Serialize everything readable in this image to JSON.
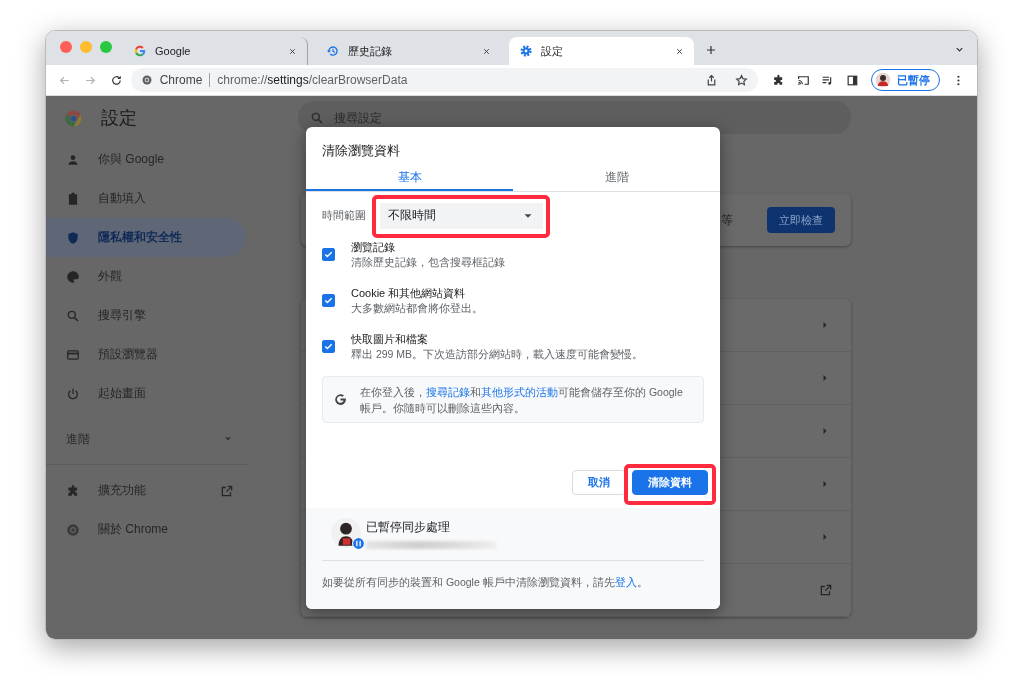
{
  "window": {
    "tabs": [
      {
        "title": "Google",
        "selected": false
      },
      {
        "title": "歷史記錄",
        "selected": false
      },
      {
        "title": "設定",
        "selected": true
      }
    ],
    "address_bar": {
      "site_label": "Chrome",
      "url": "chrome://**settings**/clearBrowserData"
    },
    "profile_chip": {
      "label": "已暫停"
    }
  },
  "settings": {
    "title": "設定",
    "search": {
      "placeholder": "搜尋設定"
    },
    "sidebar": {
      "items": [
        {
          "label": "你與 Google",
          "selected": false
        },
        {
          "label": "自動填入",
          "selected": false
        },
        {
          "label": "隱私權和安全性",
          "selected": true
        },
        {
          "label": "外觀",
          "selected": false
        },
        {
          "label": "搜尋引擎",
          "selected": false
        },
        {
          "label": "預設瀏覽器",
          "selected": false
        },
        {
          "label": "起始畫面",
          "selected": false
        }
      ],
      "advanced": {
        "label": "進階",
        "expanded": false
      },
      "bottom_items": [
        {
          "label": "擴充功能",
          "external": true
        },
        {
          "label": "關於 Chrome",
          "external": false
        }
      ]
    },
    "main": {
      "safety_card": {
        "text": "等",
        "button": "立即檢查"
      },
      "rows": [
        {
          "kind": "arrow"
        },
        {
          "kind": "arrow"
        },
        {
          "kind": "arrow"
        },
        {
          "kind": "arrow"
        },
        {
          "kind": "arrow"
        },
        {
          "kind": "external"
        }
      ]
    }
  },
  "dialog": {
    "title": "清除瀏覽資料",
    "tabs": [
      {
        "label": "基本",
        "selected": true
      },
      {
        "label": "進階",
        "selected": false
      }
    ],
    "time_range": {
      "label": "時間範圍",
      "value": "不限時間",
      "highlighted": true
    },
    "options": [
      {
        "title": "瀏覽記錄",
        "description": "清除歷史記錄，包含搜尋框記錄",
        "checked": true
      },
      {
        "title": "Cookie 和其他網站資料",
        "description": "大多數網站都會將你登出。",
        "checked": true
      },
      {
        "title": "快取圖片和檔案",
        "description": "釋出 299 MB。下次造訪部分網站時，載入速度可能會變慢。",
        "checked": true
      }
    ],
    "info": [
      {
        "text": "在你登入後，",
        "link": false
      },
      {
        "text": "搜尋記錄",
        "link": true
      },
      {
        "text": "和",
        "link": false
      },
      {
        "text": "其他形式的活動",
        "link": true
      },
      {
        "text": "可能會儲存至你的 Google 帳戶。你隨時可以刪除這些內容。",
        "link": false
      }
    ],
    "buttons": [
      {
        "label": "取消",
        "kind": "secondary",
        "highlighted": false
      },
      {
        "label": "清除資料",
        "kind": "primary",
        "highlighted": true
      }
    ],
    "sync": {
      "status": "已暫停同步處理"
    },
    "footer": [
      {
        "text": "如要從所有同步的裝置和 Google 帳戶中清除瀏覽資料，請先",
        "link": false
      },
      {
        "text": "登入",
        "link": true
      },
      {
        "text": "。",
        "link": false
      }
    ]
  }
}
